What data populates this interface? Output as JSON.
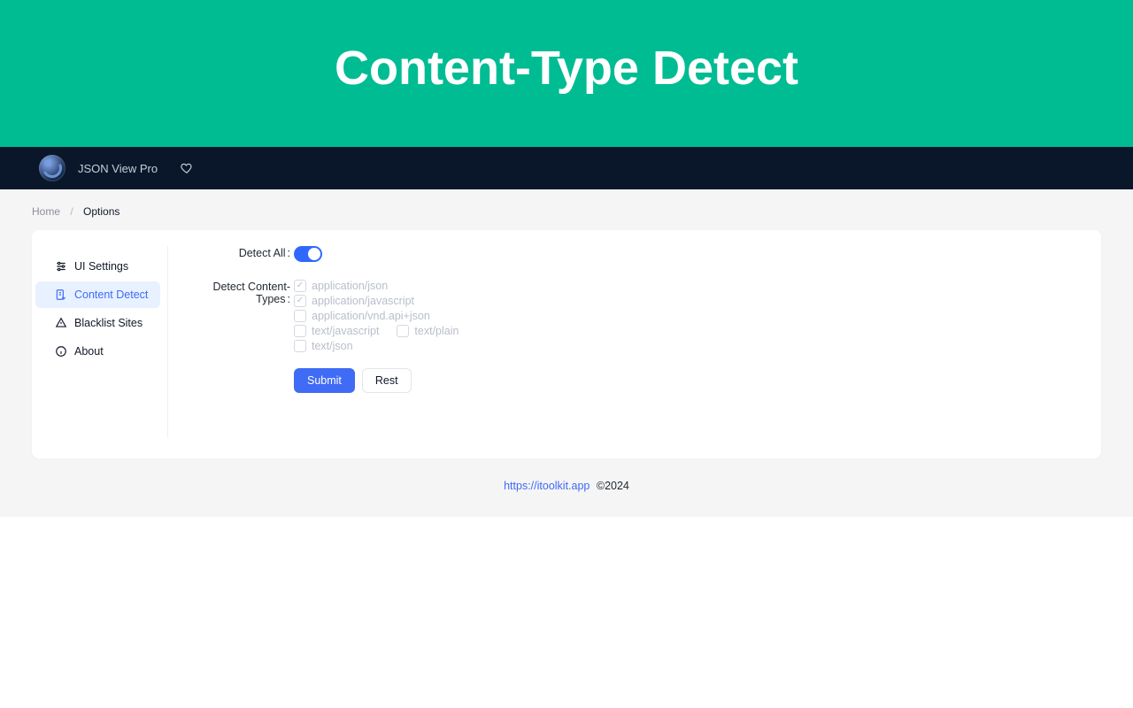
{
  "hero": {
    "title": "Content-Type Detect"
  },
  "topbar": {
    "app_name": "JSON View Pro"
  },
  "breadcrumbs": {
    "home": "Home",
    "current": "Options"
  },
  "sidebar": {
    "items": [
      {
        "label": "UI Settings"
      },
      {
        "label": "Content Detect"
      },
      {
        "label": "Blacklist Sites"
      },
      {
        "label": "About"
      }
    ],
    "active_index": 1
  },
  "form": {
    "detect_all_label": "Detect All",
    "detect_all_on": true,
    "detect_content_types_label": "Detect Content-Types",
    "content_types": [
      {
        "value": "application/json",
        "checked": true
      },
      {
        "value": "application/javascript",
        "checked": true
      },
      {
        "value": "application/vnd.api+json",
        "checked": false
      },
      {
        "value": "text/javascript",
        "checked": false
      },
      {
        "value": "text/plain",
        "checked": false
      },
      {
        "value": "text/json",
        "checked": false
      }
    ],
    "submit_label": "Submit",
    "reset_label": "Rest"
  },
  "footer": {
    "link": "https://itoolkit.app",
    "copyright": "©2024"
  }
}
